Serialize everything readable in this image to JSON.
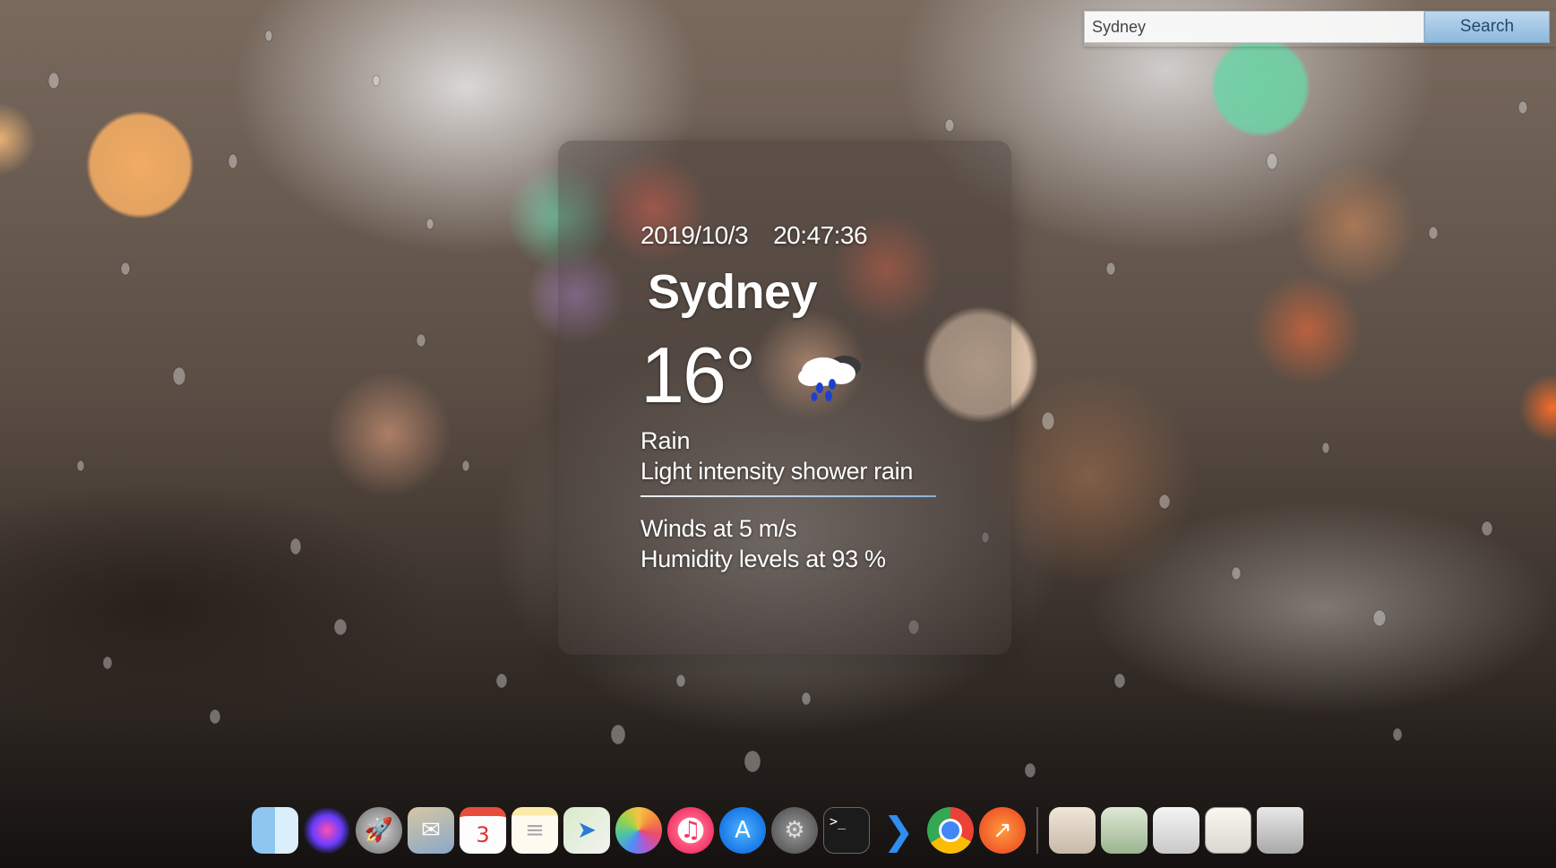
{
  "search": {
    "value": "Sydney",
    "button_label": "Search"
  },
  "weather": {
    "date": "2019/10/3",
    "time": "20:47:36",
    "city": "Sydney",
    "temperature": "16°",
    "condition_main": "Rain",
    "condition_desc": "Light intensity shower rain",
    "wind": "Winds at 5 m/s",
    "humidity": "Humidity levels at 93 %",
    "icon": "rain-cloud-icon"
  },
  "calendar_day": "3",
  "colors": {
    "card_background": "rgba(70,60,58,0.42)",
    "button_background": "#a8c9e8",
    "text": "#ffffff",
    "divider_accent": "#8cbeeb"
  },
  "dock": {
    "apps": [
      "finder-icon",
      "siri-icon",
      "launchpad-icon",
      "mail-icon",
      "calendar-icon",
      "notes-icon",
      "maps-icon",
      "photos-icon",
      "music-icon",
      "app-store-icon",
      "system-preferences-icon",
      "terminal-icon",
      "vscode-icon",
      "chrome-icon",
      "swift-icon"
    ],
    "others": [
      "folder-icon",
      "folder-icon",
      "folder-icon",
      "documents-icon",
      "trash-icon"
    ]
  }
}
